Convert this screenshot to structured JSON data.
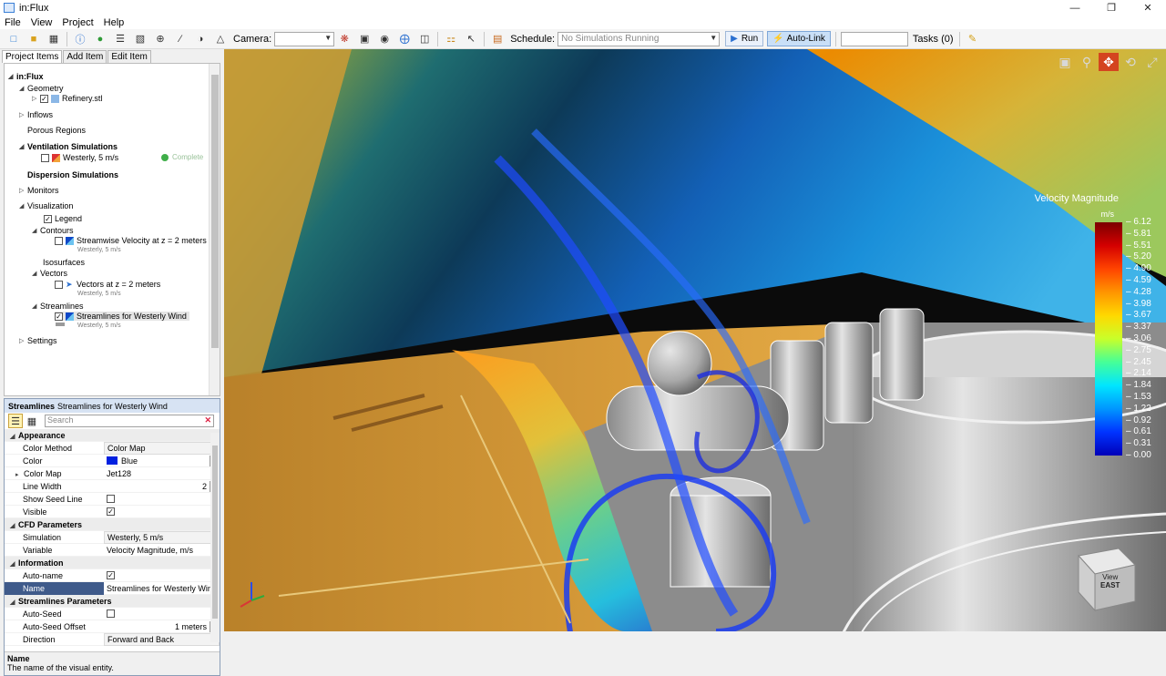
{
  "window": {
    "title": "in:Flux"
  },
  "menu": [
    "File",
    "View",
    "Project",
    "Help"
  ],
  "toolbar": {
    "camera_label": "Camera:",
    "camera_value": "",
    "run_label": "Run",
    "schedule_label": "Schedule:",
    "schedule_value": "No Simulations Running",
    "autolink_label": "Auto-Link",
    "tasks_label": "Tasks (0)"
  },
  "tabs": [
    "Project Items",
    "Add Item",
    "Edit Item"
  ],
  "tree": {
    "root": "in:Flux",
    "geometry": "Geometry",
    "refinery": "Refinery.stl",
    "inflows": "Inflows",
    "porous": "Porous Regions",
    "ventilation": "Ventilation Simulations",
    "westerly": "Westerly, 5 m/s",
    "complete": "Complete",
    "dispersion": "Dispersion Simulations",
    "monitors": "Monitors",
    "visualization": "Visualization",
    "legend": "Legend",
    "contours": "Contours",
    "contour_item": "Streamwise Velocity at z = 2 meters",
    "contour_sub": "Westerly, 5 m/s",
    "isosurfaces": "Isosurfaces",
    "vectors": "Vectors",
    "vector_item": "Vectors at z = 2 meters",
    "vector_sub": "Westerly, 5 m/s",
    "streamlines": "Streamlines",
    "stream_item": "Streamlines for Westerly Wind",
    "stream_sub": "Westerly, 5 m/s",
    "settings": "Settings"
  },
  "props": {
    "header_type": "Streamlines",
    "header_name": "Streamlines for Westerly Wind",
    "search_placeholder": "Search",
    "rows": {
      "appearance": "Appearance",
      "color_method_k": "Color Method",
      "color_method_v": "Color Map",
      "color_k": "Color",
      "color_v": "Blue",
      "color_map_k": "Color Map",
      "color_map_v": "Jet128",
      "line_width_k": "Line Width",
      "line_width_v": "2",
      "show_seed_k": "Show Seed Line",
      "visible_k": "Visible",
      "cfd": "CFD Parameters",
      "simulation_k": "Simulation",
      "simulation_v": "Westerly, 5 m/s",
      "variable_k": "Variable",
      "variable_v": "Velocity Magnitude, m/s",
      "information": "Information",
      "autoname_k": "Auto-name",
      "name_k": "Name",
      "name_v": "Streamlines for Westerly Wind",
      "sl_params": "Streamlines Parameters",
      "autoseed_k": "Auto-Seed",
      "autoseed_offset_k": "Auto-Seed Offset",
      "autoseed_offset_v": "1 meters",
      "direction_k": "Direction",
      "direction_v": "Forward and Back"
    },
    "desc_title": "Name",
    "desc_text": "The name of the visual entity."
  },
  "legend": {
    "title": "Velocity Magnitude",
    "unit": "m/s",
    "ticks": [
      "6.12",
      "5.81",
      "5.51",
      "5.20",
      "4.90",
      "4.59",
      "4.28",
      "3.98",
      "3.67",
      "3.37",
      "3.06",
      "2.75",
      "2.45",
      "2.14",
      "1.84",
      "1.53",
      "1.22",
      "0.92",
      "0.61",
      "0.31",
      "0.00"
    ],
    "colors": {
      "high": "#7b0000",
      "mid": "#ffd900",
      "low": "#0000b8"
    }
  },
  "viewcube": {
    "label1": "View",
    "label2": "EAST"
  },
  "colors": {
    "accent": "#d4451f",
    "selection": "#3f5a8a",
    "blue_swatch": "#0020e0"
  }
}
